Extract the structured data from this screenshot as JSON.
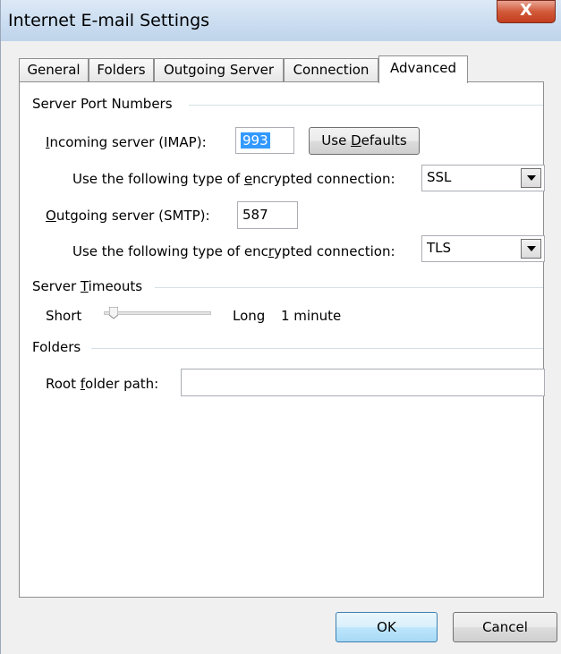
{
  "window": {
    "title": "Internet E-mail Settings",
    "close_glyph": "X"
  },
  "tabs": [
    {
      "label": "General",
      "active": false
    },
    {
      "label": "Folders",
      "active": false
    },
    {
      "label": "Outgoing Server",
      "active": false
    },
    {
      "label": "Connection",
      "active": false
    },
    {
      "label": "Advanced",
      "active": true
    }
  ],
  "server_ports": {
    "heading": "Server Port Numbers",
    "incoming_label_pre": "",
    "incoming_label_u": "I",
    "incoming_label_post": "ncoming server (IMAP):",
    "incoming_value": "993",
    "use_defaults_pre": "Use ",
    "use_defaults_u": "D",
    "use_defaults_post": "efaults",
    "enc1_label_pre": "Use the following type of ",
    "enc1_label_u": "e",
    "enc1_label_post": "ncrypted connection:",
    "enc1_value": "SSL",
    "outgoing_label_u": "O",
    "outgoing_label_post": "utgoing server (SMTP):",
    "outgoing_value": "587",
    "enc2_label_pre": "Use the following type of enc",
    "enc2_label_u": "r",
    "enc2_label_post": "ypted connection:",
    "enc2_value": "TLS"
  },
  "timeouts": {
    "heading_pre": "Server ",
    "heading_u": "T",
    "heading_post": "imeouts",
    "short_label": "Short",
    "long_label": "Long",
    "value_text": "1 minute",
    "slider_level": 0.05
  },
  "folders": {
    "heading": "Folders",
    "root_label_pre": "Root ",
    "root_label_u": "f",
    "root_label_post": "older path:",
    "root_value": ""
  },
  "buttons": {
    "ok": "OK",
    "cancel": "Cancel"
  },
  "colors": {
    "selection": "#3399ff",
    "close_button": "#c33e1f",
    "default_button_border": "#3c7fb1"
  }
}
